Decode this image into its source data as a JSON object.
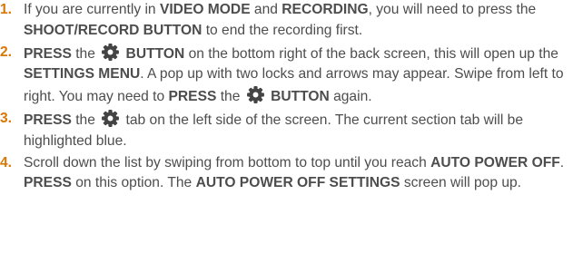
{
  "accent_color": "#d97706",
  "text_color": "#4d4d4d",
  "steps": [
    {
      "number": "1.",
      "segments": [
        {
          "t": "If you are currently in ",
          "b": false
        },
        {
          "t": "VIDEO MODE",
          "b": true
        },
        {
          "t": " and ",
          "b": false
        },
        {
          "t": "RECORDING",
          "b": true
        },
        {
          "t": ", you will need to press the ",
          "b": false
        },
        {
          "t": "SHOOT/RECORD BUTTON",
          "b": true
        },
        {
          "t": " to end the recording first.",
          "b": false
        }
      ]
    },
    {
      "number": "2.",
      "segments": [
        {
          "t": "PRESS",
          "b": true
        },
        {
          "t": " the ",
          "b": false
        },
        {
          "icon": "gear-icon"
        },
        {
          "t": " BUTTON",
          "b": true
        },
        {
          "t": " on the bottom right of the back screen, this will open up the ",
          "b": false
        },
        {
          "t": "SETTINGS MENU",
          "b": true
        },
        {
          "t": ". A pop up with two locks and arrows may appear. Swipe from left to right. You may need to ",
          "b": false
        },
        {
          "t": "PRESS",
          "b": true
        },
        {
          "t": " the ",
          "b": false
        },
        {
          "icon": "gear-icon"
        },
        {
          "t": " BUTTON",
          "b": true
        },
        {
          "t": " again.",
          "b": false
        }
      ]
    },
    {
      "number": "3.",
      "segments": [
        {
          "t": "PRESS",
          "b": true
        },
        {
          "t": " the ",
          "b": false
        },
        {
          "icon": "gear-icon"
        },
        {
          "t": " tab on the left side of the screen. The current section tab will be highlighted blue.",
          "b": false
        }
      ]
    },
    {
      "number": "4.",
      "segments": [
        {
          "t": "Scroll down the list by swiping from bottom to top until you reach ",
          "b": false
        },
        {
          "t": "AUTO POWER OFF",
          "b": true
        },
        {
          "t": ". ",
          "b": false
        },
        {
          "t": "PRESS",
          "b": true
        },
        {
          "t": " on this option. The ",
          "b": false
        },
        {
          "t": "AUTO POWER OFF SETTINGS",
          "b": true
        },
        {
          "t": " screen will pop up.",
          "b": false
        }
      ]
    }
  ]
}
